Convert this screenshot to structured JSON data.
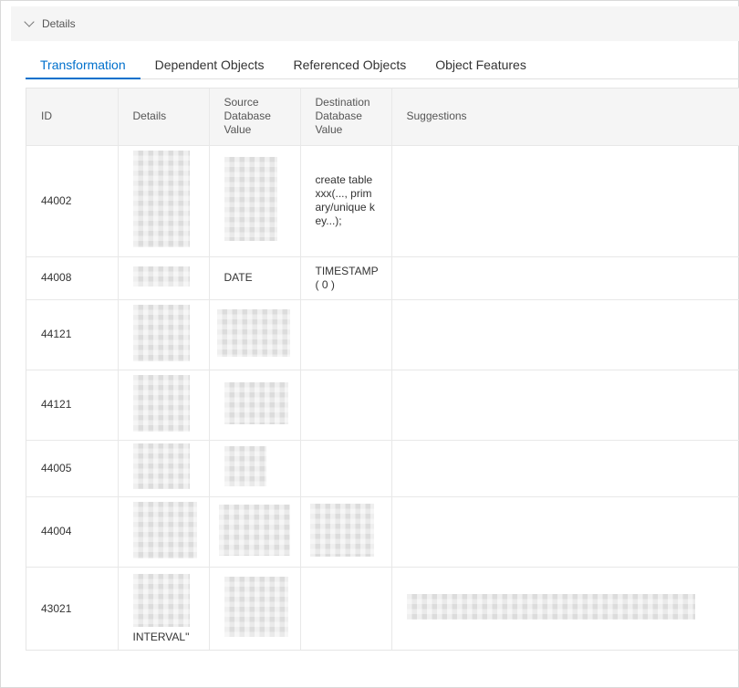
{
  "panel": {
    "title": "Details"
  },
  "tabs": [
    {
      "label": "Transformation",
      "active": true
    },
    {
      "label": "Dependent Objects",
      "active": false
    },
    {
      "label": "Referenced Objects",
      "active": false
    },
    {
      "label": "Object Features",
      "active": false
    }
  ],
  "table": {
    "columns": [
      "ID",
      "Details",
      "Source Database Value",
      "Destination Database Value",
      "Suggestions"
    ],
    "rows": [
      {
        "id": "44002",
        "details": "",
        "source": "",
        "destination": "create table xxx(..., primary/unique key...);",
        "suggestions": ""
      },
      {
        "id": "44008",
        "details": "",
        "source": "DATE",
        "destination": "TIMESTAMP ( 0 )",
        "suggestions": ""
      },
      {
        "id": "44121",
        "details": "",
        "source": "",
        "destination": "",
        "suggestions": ""
      },
      {
        "id": "44121",
        "details": "",
        "source": "",
        "destination": "",
        "suggestions": ""
      },
      {
        "id": "44005",
        "details": "",
        "source": "",
        "destination": "",
        "suggestions": ""
      },
      {
        "id": "44004",
        "details": "",
        "source": "",
        "destination": "",
        "suggestions": ""
      },
      {
        "id": "43021",
        "details": "INTERVAL\"",
        "source": "",
        "destination": "",
        "suggestions": ""
      }
    ]
  },
  "colors": {
    "accent": "#0070cc",
    "header_bg": "#f5f5f5",
    "border": "#e8e8e8"
  }
}
